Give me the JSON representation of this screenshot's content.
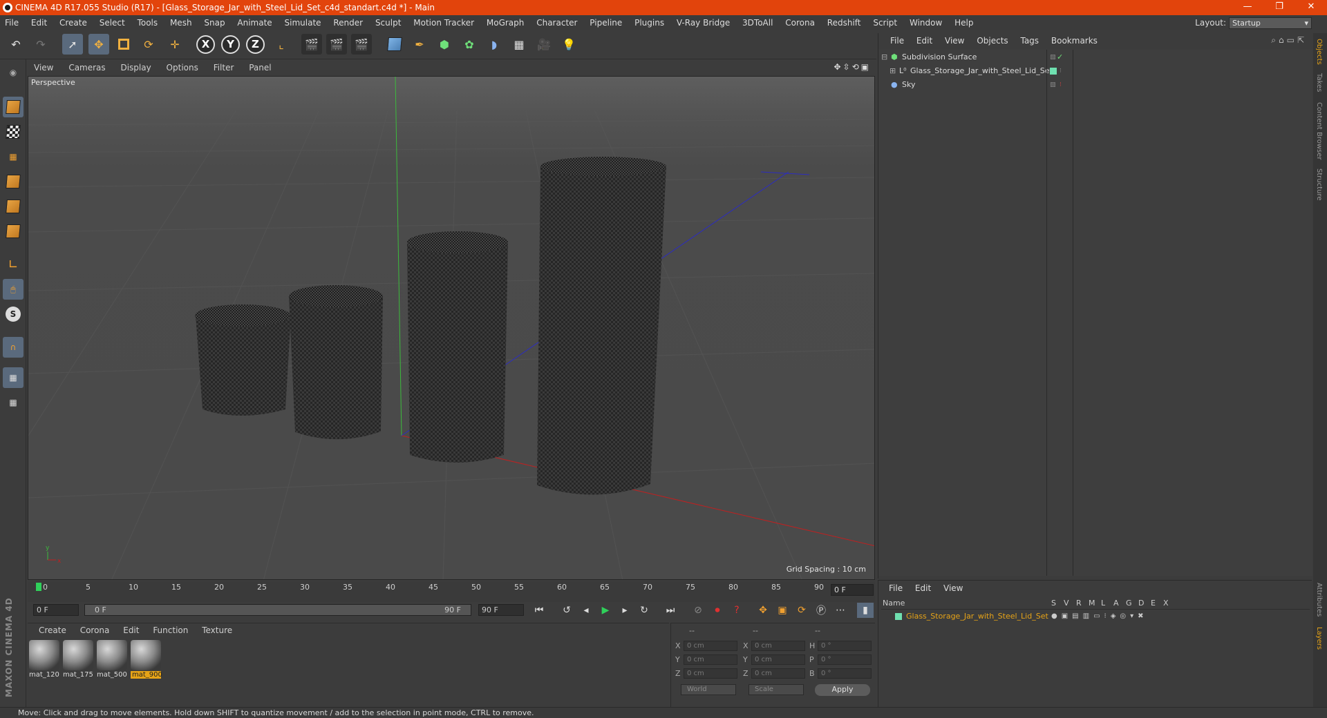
{
  "window": {
    "title": "CINEMA 4D R17.055 Studio (R17) - [Glass_Storage_Jar_with_Steel_Lid_Set_c4d_standart.c4d *] - Main",
    "minimize": "—",
    "restore": "❐",
    "close": "✕"
  },
  "menubar": {
    "items": [
      "File",
      "Edit",
      "Create",
      "Select",
      "Tools",
      "Mesh",
      "Snap",
      "Animate",
      "Simulate",
      "Render",
      "Sculpt",
      "Motion Tracker",
      "MoGraph",
      "Character",
      "Pipeline",
      "Plugins",
      "V-Ray Bridge",
      "3DToAll",
      "Corona",
      "Redshift",
      "Script",
      "Window",
      "Help"
    ],
    "layout_label": "Layout:",
    "layout_value": "Startup"
  },
  "toolbar": {
    "axis_x": "X",
    "axis_y": "Y",
    "axis_z": "Z"
  },
  "viewport": {
    "menu": [
      "View",
      "Cameras",
      "Display",
      "Options",
      "Filter",
      "Panel"
    ],
    "label": "Perspective",
    "grid_spacing": "Grid Spacing : 10 cm"
  },
  "timeline": {
    "ticks": [
      "0",
      "5",
      "10",
      "15",
      "20",
      "25",
      "30",
      "35",
      "40",
      "45",
      "50",
      "55",
      "60",
      "65",
      "70",
      "75",
      "80",
      "85",
      "90"
    ],
    "current_frame": "0 F",
    "start_field": "0 F",
    "range_start": "0 F",
    "range_end": "90 F",
    "end_field": "90 F"
  },
  "materials": {
    "menu": [
      "Create",
      "Corona",
      "Edit",
      "Function",
      "Texture"
    ],
    "items": [
      {
        "name": "mat_120"
      },
      {
        "name": "mat_175"
      },
      {
        "name": "mat_500"
      },
      {
        "name": "mat_900"
      }
    ]
  },
  "coords": {
    "headers": [
      "--",
      "--",
      "--"
    ],
    "rows": [
      {
        "a_label": "X",
        "a_val": "0 cm",
        "b_label": "X",
        "b_val": "0 cm",
        "c_label": "H",
        "c_val": "0 °"
      },
      {
        "a_label": "Y",
        "a_val": "0 cm",
        "b_label": "Y",
        "b_val": "0 cm",
        "c_label": "P",
        "c_val": "0 °"
      },
      {
        "a_label": "Z",
        "a_val": "0 cm",
        "b_label": "Z",
        "b_val": "0 cm",
        "c_label": "B",
        "c_val": "0 °"
      }
    ],
    "world": "World",
    "scale": "Scale",
    "apply": "Apply"
  },
  "objects": {
    "menu": [
      "File",
      "Edit",
      "View",
      "Objects",
      "Tags",
      "Bookmarks"
    ],
    "items": [
      {
        "name": "Subdivision Surface"
      },
      {
        "name": "Glass_Storage_Jar_with_Steel_Lid_Set"
      },
      {
        "name": "Sky"
      }
    ]
  },
  "layers": {
    "menu": [
      "File",
      "Edit",
      "View"
    ],
    "header_name": "Name",
    "header_cols": [
      "S",
      "V",
      "R",
      "M",
      "L",
      "A",
      "G",
      "D",
      "E",
      "X"
    ],
    "row_name": "Glass_Storage_Jar_with_Steel_Lid_Set"
  },
  "side_tabs": [
    "Objects",
    "Takes",
    "Content Browser",
    "Structure"
  ],
  "side_tabs_bottom": [
    "Attributes",
    "Layers"
  ],
  "branding": "MAXON CINEMA 4D",
  "status": "Move: Click and drag to move elements. Hold down SHIFT to quantize movement / add to the selection in point mode, CTRL to remove.",
  "colors": {
    "titlebar": "#e2440c",
    "selection": "#e6a317",
    "layer_swatch": "#6fe0b0"
  }
}
